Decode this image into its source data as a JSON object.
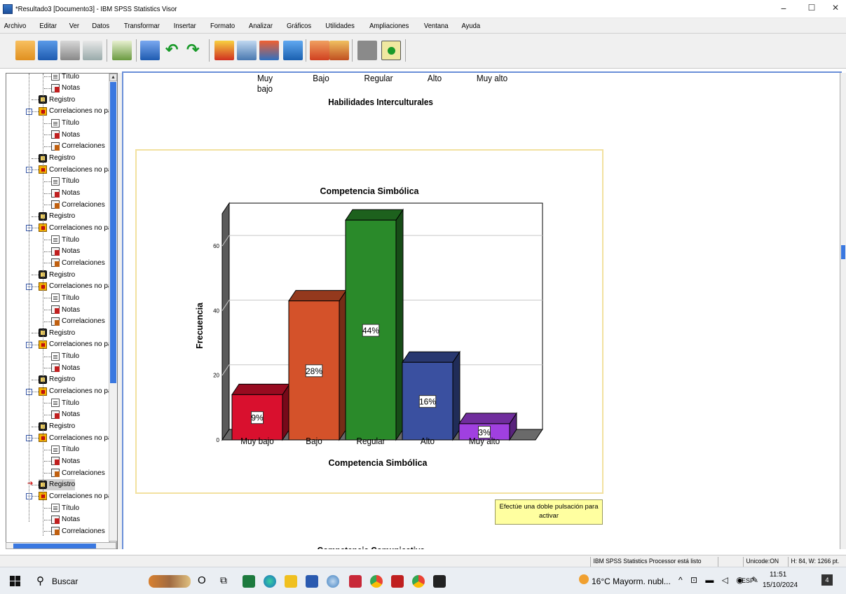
{
  "window": {
    "title": "*Resultado3 [Documento3] - IBM SPSS Statistics Visor",
    "minimize": "−",
    "maximize": "☐",
    "close": "✕"
  },
  "menu": [
    "Archivo",
    "Editar",
    "Ver",
    "Datos",
    "Transformar",
    "Insertar",
    "Formato",
    "Analizar",
    "Gráficos",
    "Utilidades",
    "Ampliaciones",
    "Ventana",
    "Ayuda"
  ],
  "toolbar_icons": [
    "open-icon",
    "save-icon",
    "print-icon",
    "print-preview-icon",
    "export-icon",
    "recall-dialog-icon",
    "undo-icon",
    "redo-icon",
    "goto-data-icon",
    "goto-variable-icon",
    "variables-icon",
    "last-output-icon",
    "create-title-icon",
    "create-text-icon",
    "designate-window-icon",
    "show-all-icon"
  ],
  "tree": {
    "items": [
      {
        "type": "titulo",
        "label": "Título"
      },
      {
        "type": "notas",
        "label": "Notas"
      },
      {
        "type": "registro",
        "label": "Registro"
      },
      {
        "type": "folder",
        "label": "Correlaciones no pa"
      },
      {
        "type": "titulo",
        "label": "Título"
      },
      {
        "type": "notas",
        "label": "Notas"
      },
      {
        "type": "correlaciones",
        "label": "Correlaciones"
      },
      {
        "type": "registro",
        "label": "Registro"
      },
      {
        "type": "folder",
        "label": "Correlaciones no pa"
      },
      {
        "type": "titulo",
        "label": "Título"
      },
      {
        "type": "notas",
        "label": "Notas"
      },
      {
        "type": "correlaciones",
        "label": "Correlaciones"
      },
      {
        "type": "registro",
        "label": "Registro"
      },
      {
        "type": "folder",
        "label": "Correlaciones no pa"
      },
      {
        "type": "titulo",
        "label": "Título"
      },
      {
        "type": "notas",
        "label": "Notas"
      },
      {
        "type": "correlaciones",
        "label": "Correlaciones"
      },
      {
        "type": "registro",
        "label": "Registro"
      },
      {
        "type": "folder",
        "label": "Correlaciones no pa"
      },
      {
        "type": "titulo",
        "label": "Título"
      },
      {
        "type": "notas",
        "label": "Notas"
      },
      {
        "type": "correlaciones",
        "label": "Correlaciones"
      },
      {
        "type": "registro",
        "label": "Registro"
      },
      {
        "type": "folder",
        "label": "Correlaciones no pa"
      },
      {
        "type": "titulo",
        "label": "Título"
      },
      {
        "type": "notas",
        "label": "Notas"
      },
      {
        "type": "registro",
        "label": "Registro"
      },
      {
        "type": "folder",
        "label": "Correlaciones no pa"
      },
      {
        "type": "titulo",
        "label": "Título"
      },
      {
        "type": "notas",
        "label": "Notas"
      },
      {
        "type": "registro",
        "label": "Registro"
      },
      {
        "type": "folder",
        "label": "Correlaciones no pa"
      },
      {
        "type": "titulo",
        "label": "Título"
      },
      {
        "type": "notas",
        "label": "Notas"
      },
      {
        "type": "correlaciones",
        "label": "Correlaciones"
      },
      {
        "type": "registro",
        "label": "Registro",
        "selected": true
      },
      {
        "type": "folder",
        "label": "Correlaciones no pa"
      },
      {
        "type": "titulo",
        "label": "Título"
      },
      {
        "type": "notas",
        "label": "Notas"
      },
      {
        "type": "correlaciones",
        "label": "Correlaciones"
      }
    ]
  },
  "prev_chart": {
    "categories": [
      "Muy bajo",
      "Bajo",
      "Regular",
      "Alto",
      "Muy alto"
    ],
    "xlabel": "Habilidades Interculturales"
  },
  "chart_data": {
    "type": "bar",
    "title": "Competencia Simbólica",
    "xlabel": "Competencia Simbólica",
    "ylabel": "Frecuencia",
    "categories": [
      "Muy bajo",
      "Bajo",
      "Regular",
      "Alto",
      "Muy alto"
    ],
    "values": [
      14,
      43,
      68,
      24,
      5
    ],
    "percent_labels": [
      "9%",
      "28%",
      "44%",
      "16%",
      "3%"
    ],
    "colors": [
      "#d9102e",
      "#d4522a",
      "#2a8a2a",
      "#3a50a0",
      "#a040e0"
    ],
    "yticks": [
      0,
      20,
      40,
      60
    ],
    "ylim": [
      0,
      70
    ],
    "grid": true,
    "style": "3d"
  },
  "tooltip": "Efectúe una doble pulsación para activar",
  "next_heading": "Competencia Comunicativa",
  "status": {
    "processor": "IBM SPSS Statistics Processor está listo",
    "unicode": "Unicode:ON",
    "dims": "H: 84, W: 1266 pt."
  },
  "taskbar": {
    "search": "Buscar",
    "weather": "16°C  Mayorm. nubl...",
    "lang": "ESP",
    "time": "11:51",
    "date": "15/10/2024",
    "notif_count": "4"
  }
}
